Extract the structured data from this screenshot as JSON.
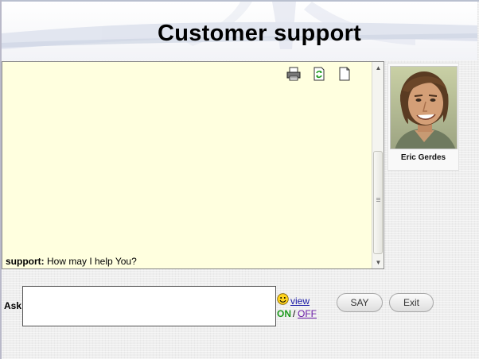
{
  "header": {
    "title": "Customer support"
  },
  "chat": {
    "toolbar": {
      "print_icon": "printer-icon",
      "refresh_icon": "refresh-icon",
      "new_icon": "blank-page-icon"
    },
    "messages": [
      {
        "sender": "support:",
        "text": "How may I help You?"
      }
    ]
  },
  "agent": {
    "name": "Eric Gerdes",
    "photo": "agent-photo"
  },
  "ask": {
    "label": "Ask",
    "input_value": "",
    "view_label": "view",
    "on_label": "ON",
    "separator": "/",
    "off_label": "OFF"
  },
  "buttons": {
    "say_label": "SAY",
    "exit_label": "Exit"
  },
  "colors": {
    "chat_bg": "#ffffdf",
    "on_green": "#1e9a1e",
    "link_blue": "#1a1aa6",
    "visited_purple": "#6a1aa6"
  }
}
